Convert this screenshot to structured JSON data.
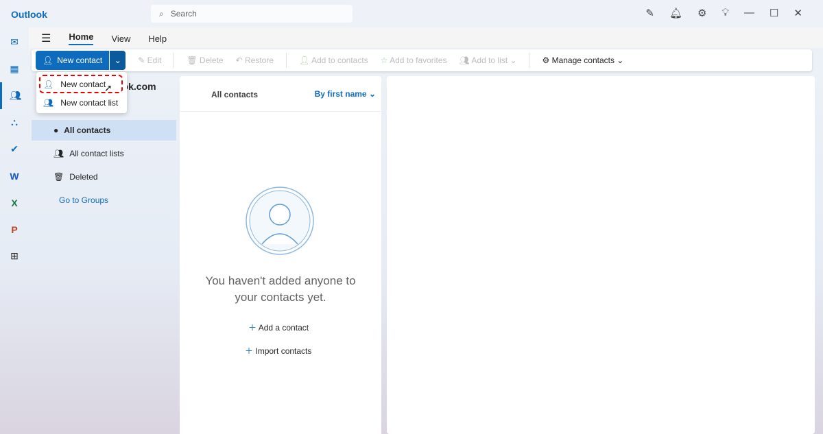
{
  "app": {
    "title": "Outlook",
    "search_placeholder": "Search"
  },
  "menu": {
    "home": "Home",
    "view": "View",
    "help": "Help"
  },
  "ribbon": {
    "new_contact": "New contact",
    "edit": "Edit",
    "delete": "Delete",
    "restore": "Restore",
    "add_to_contacts": "Add to contacts",
    "add_to_favorites": "Add to favorites",
    "add_to_list": "Add to list",
    "manage_contacts": "Manage contacts"
  },
  "dropdown": {
    "new_contact": "New contact",
    "new_contact_list": "New contact list"
  },
  "sidebar": {
    "account": "ook.com",
    "items": [
      {
        "label": "All contacts"
      },
      {
        "label": "All contact lists"
      },
      {
        "label": "Deleted"
      }
    ],
    "groups_link": "Go to Groups"
  },
  "list": {
    "header": "All contacts",
    "sort": "By first name",
    "empty_line1": "You haven't added anyone to",
    "empty_line2": "your contacts yet.",
    "add": "Add a contact",
    "import": "Import contacts"
  }
}
